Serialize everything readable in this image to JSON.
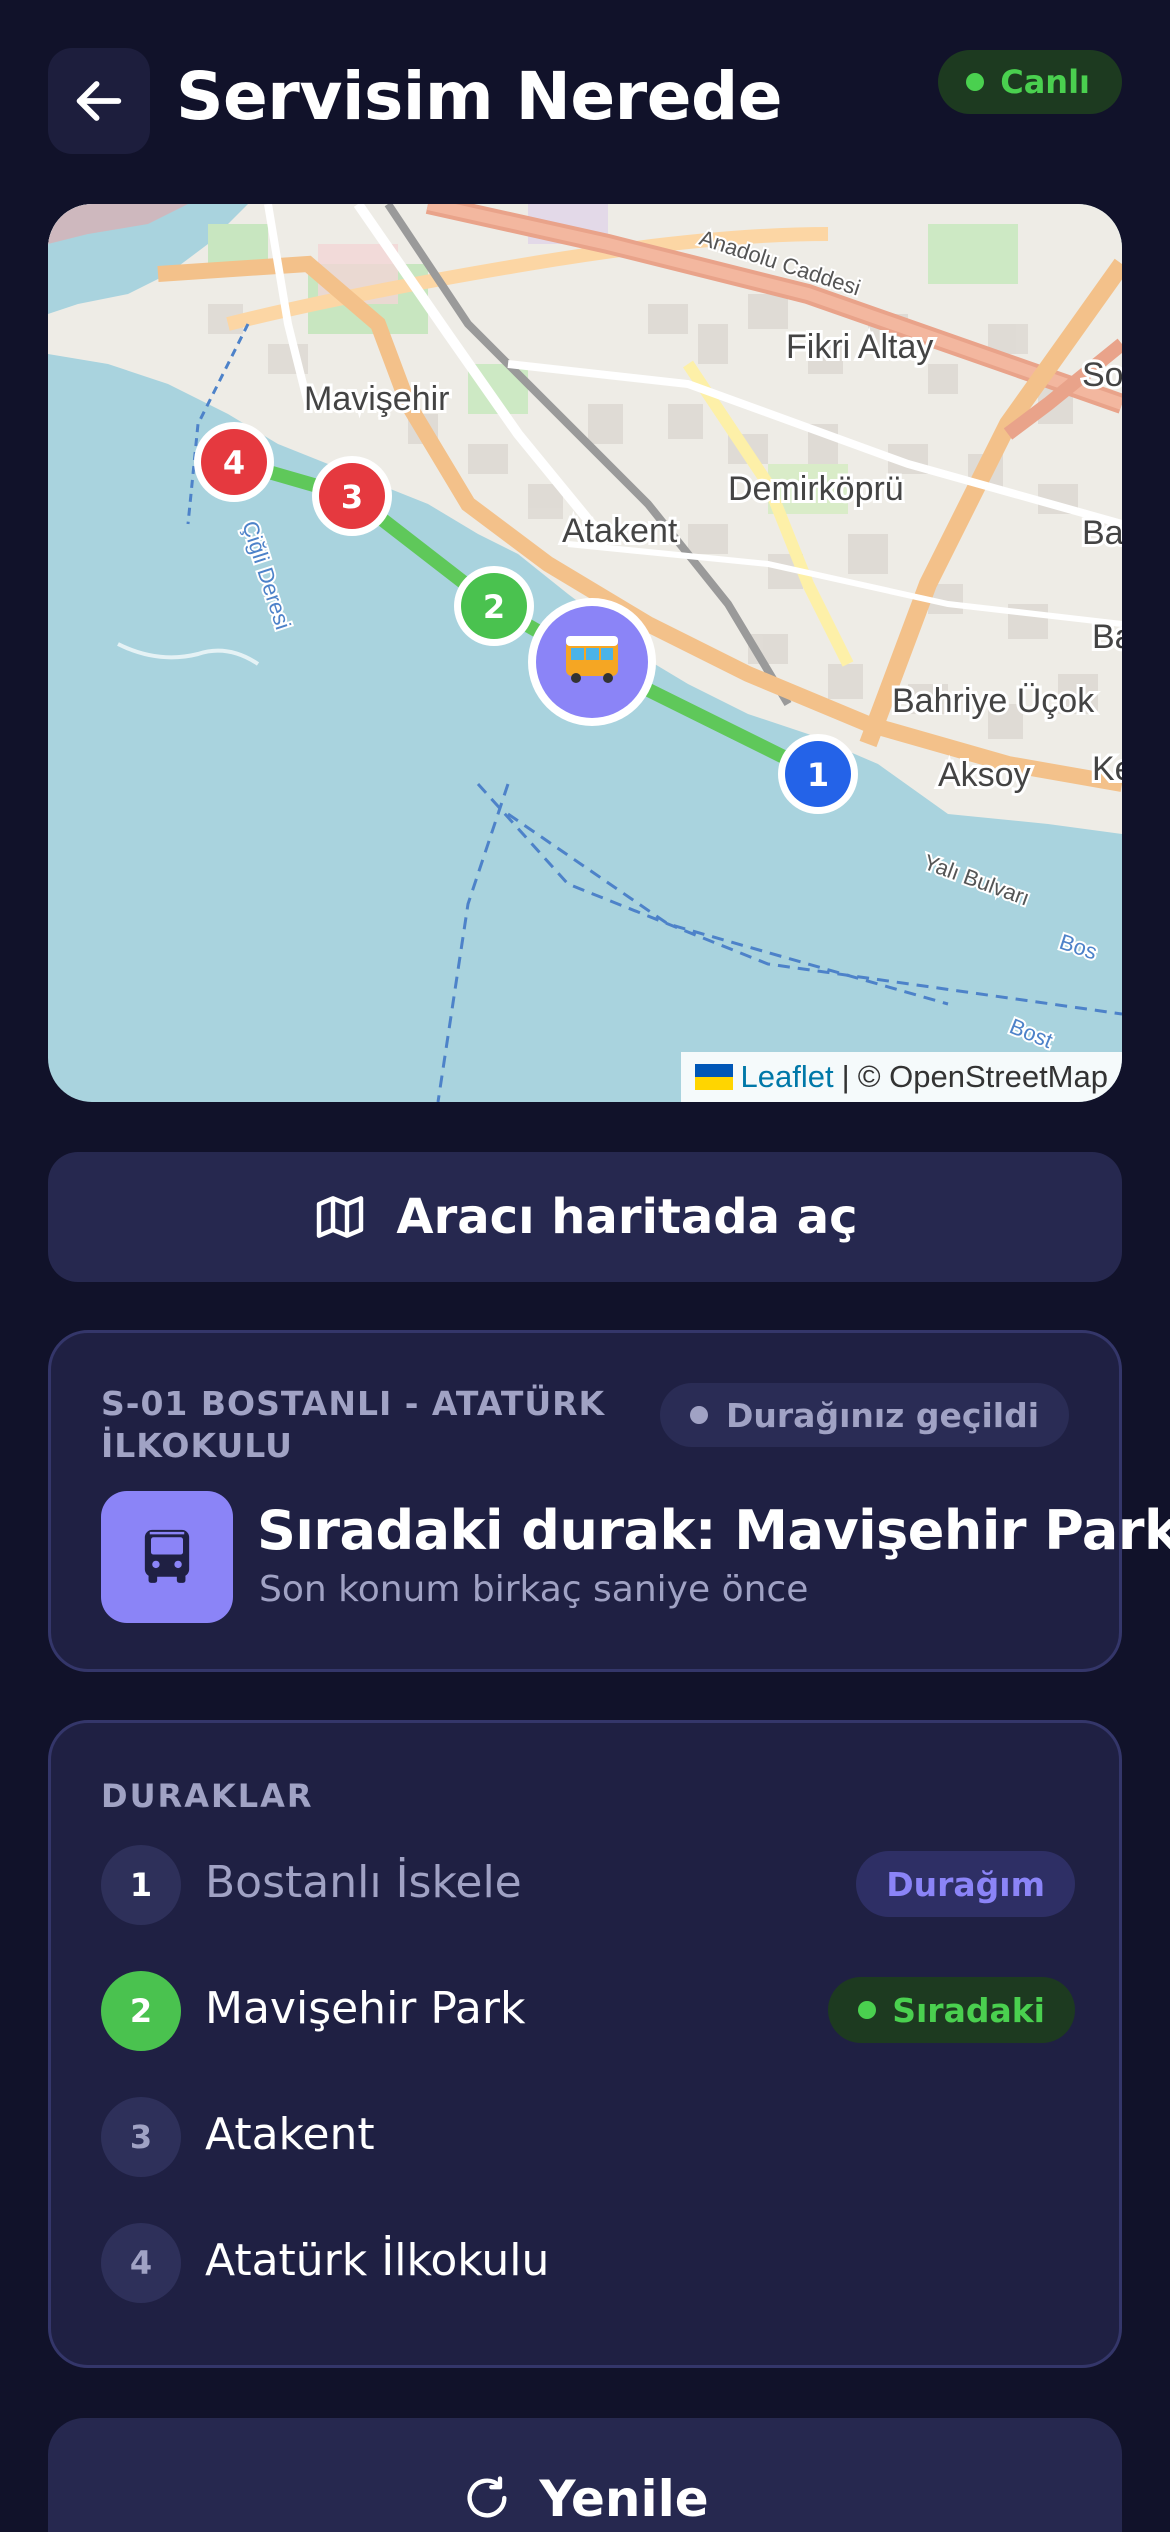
{
  "header": {
    "title": "Servisim Nerede",
    "live_label": "Canlı",
    "back_icon": "arrow-left-icon"
  },
  "map": {
    "place_labels": [
      "Mavişehir",
      "Atakent",
      "Demirköprü",
      "Fikri Altay",
      "Bahriye Üçok",
      "Aksoy",
      "Anadolu Caddesi",
      "Yalı Bulvarı",
      "Bahçe",
      "Baha",
      "Ke",
      "So",
      "Bos",
      "Bost",
      "Çiğli Deresi"
    ],
    "markers": [
      "1",
      "2",
      "3",
      "4"
    ],
    "vehicle_icon": "bus-icon",
    "attribution": {
      "leaflet": "Leaflet",
      "separator": "|",
      "osm": "© OpenStreetMap"
    }
  },
  "open_map_button": {
    "label": "Aracı haritada aç",
    "icon": "map-icon"
  },
  "status": {
    "route": "S-01 BOSTANLI - ATATÜRK İLKOKULU",
    "passed_label": "Durağınız geçildi",
    "next_stop": "Sıradaki durak: Mavişehir Park",
    "last_seen": "Son konum birkaç saniye önce"
  },
  "stops": {
    "heading": "DURAKLAR",
    "items": [
      {
        "num": "1",
        "label": "Bostanlı İskele",
        "badge": "Durağım"
      },
      {
        "num": "2",
        "label": "Mavişehir Park",
        "badge": "Sıradaki"
      },
      {
        "num": "3",
        "label": "Atakent",
        "badge": ""
      },
      {
        "num": "4",
        "label": "Atatürk İlkokulu",
        "badge": ""
      }
    ]
  },
  "refresh_button": {
    "label": "Yenile",
    "icon": "refresh-icon"
  },
  "colors": {
    "background": "#11122a",
    "card": "#1f2043",
    "accent_purple": "#8b84f7",
    "live_green": "#4ad04f",
    "stop_red": "#e5393f",
    "stop_blue": "#2463e8"
  }
}
